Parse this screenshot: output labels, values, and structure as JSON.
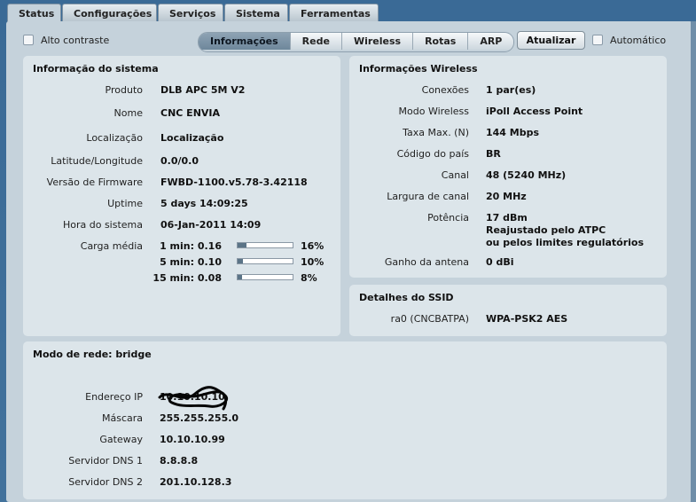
{
  "tabs": [
    {
      "label": "Status",
      "active": true
    },
    {
      "label": "Configurações"
    },
    {
      "label": "Serviços"
    },
    {
      "label": "Sistema"
    },
    {
      "label": "Ferramentas"
    }
  ],
  "toolbar": {
    "high_contrast_label": "Alto contraste",
    "nav": [
      {
        "label": "Informações",
        "active": true
      },
      {
        "label": "Rede"
      },
      {
        "label": "Wireless"
      },
      {
        "label": "Rotas"
      },
      {
        "label": "ARP"
      }
    ],
    "refresh_label": "Atualizar",
    "auto_label": "Automático"
  },
  "system_info": {
    "title": "Informação do sistema",
    "rows": [
      {
        "label": "Produto",
        "value": "DLB APC 5M V2"
      },
      {
        "label": "Nome",
        "value": "CNC ENVIA"
      },
      {
        "label": "Localização",
        "value": "Localização"
      },
      {
        "label": "Latitude/Longitude",
        "value": "0.0/0.0"
      },
      {
        "label": "Versão de Firmware",
        "value": "FWBD-1100.v5.78-3.42118"
      },
      {
        "label": "Uptime",
        "value": "5 days 14:09:25"
      },
      {
        "label": "Hora do sistema",
        "value": "06-Jan-2011 14:09"
      }
    ],
    "load_label": "Carga média",
    "load": [
      {
        "label": "1 min: 0.16",
        "percent_text": "16%",
        "fraction": 0.16
      },
      {
        "label": "5 min: 0.10",
        "percent_text": "10%",
        "fraction": 0.1
      },
      {
        "label": "15 min: 0.08",
        "percent_text": "8%",
        "fraction": 0.08
      }
    ]
  },
  "wireless_info": {
    "title": "Informações Wireless",
    "rows": [
      {
        "label": "Conexões",
        "value": "1 par(es)"
      },
      {
        "label": "Modo Wireless",
        "value": "iPoll Access Point"
      },
      {
        "label": "Taxa Max. (N)",
        "value": "144 Mbps"
      },
      {
        "label": "Código do país",
        "value": "BR"
      },
      {
        "label": "Canal",
        "value": "48 (5240 MHz)"
      },
      {
        "label": "Largura de canal",
        "value": "20 MHz"
      },
      {
        "label": "Potência",
        "value": "17 dBm",
        "extra1": "Reajustado pelo ATPC",
        "extra2": "ou pelos limites regulatórios"
      },
      {
        "label": "Ganho da antena",
        "value": "0 dBi"
      }
    ]
  },
  "ssid": {
    "title": "Detalhes do SSID",
    "label": "ra0 (CNCBATPA)",
    "value": "WPA-PSK2 AES"
  },
  "network": {
    "title": "Modo de rede: bridge",
    "rows": [
      {
        "label": "Endereço IP",
        "value": "10.10.10.10"
      },
      {
        "label": "Máscara",
        "value": "255.255.255.0"
      },
      {
        "label": "Gateway",
        "value": "10.10.10.99"
      },
      {
        "label": "Servidor DNS 1",
        "value": "8.8.8.8"
      },
      {
        "label": "Servidor DNS 2",
        "value": "201.10.128.3"
      }
    ]
  }
}
